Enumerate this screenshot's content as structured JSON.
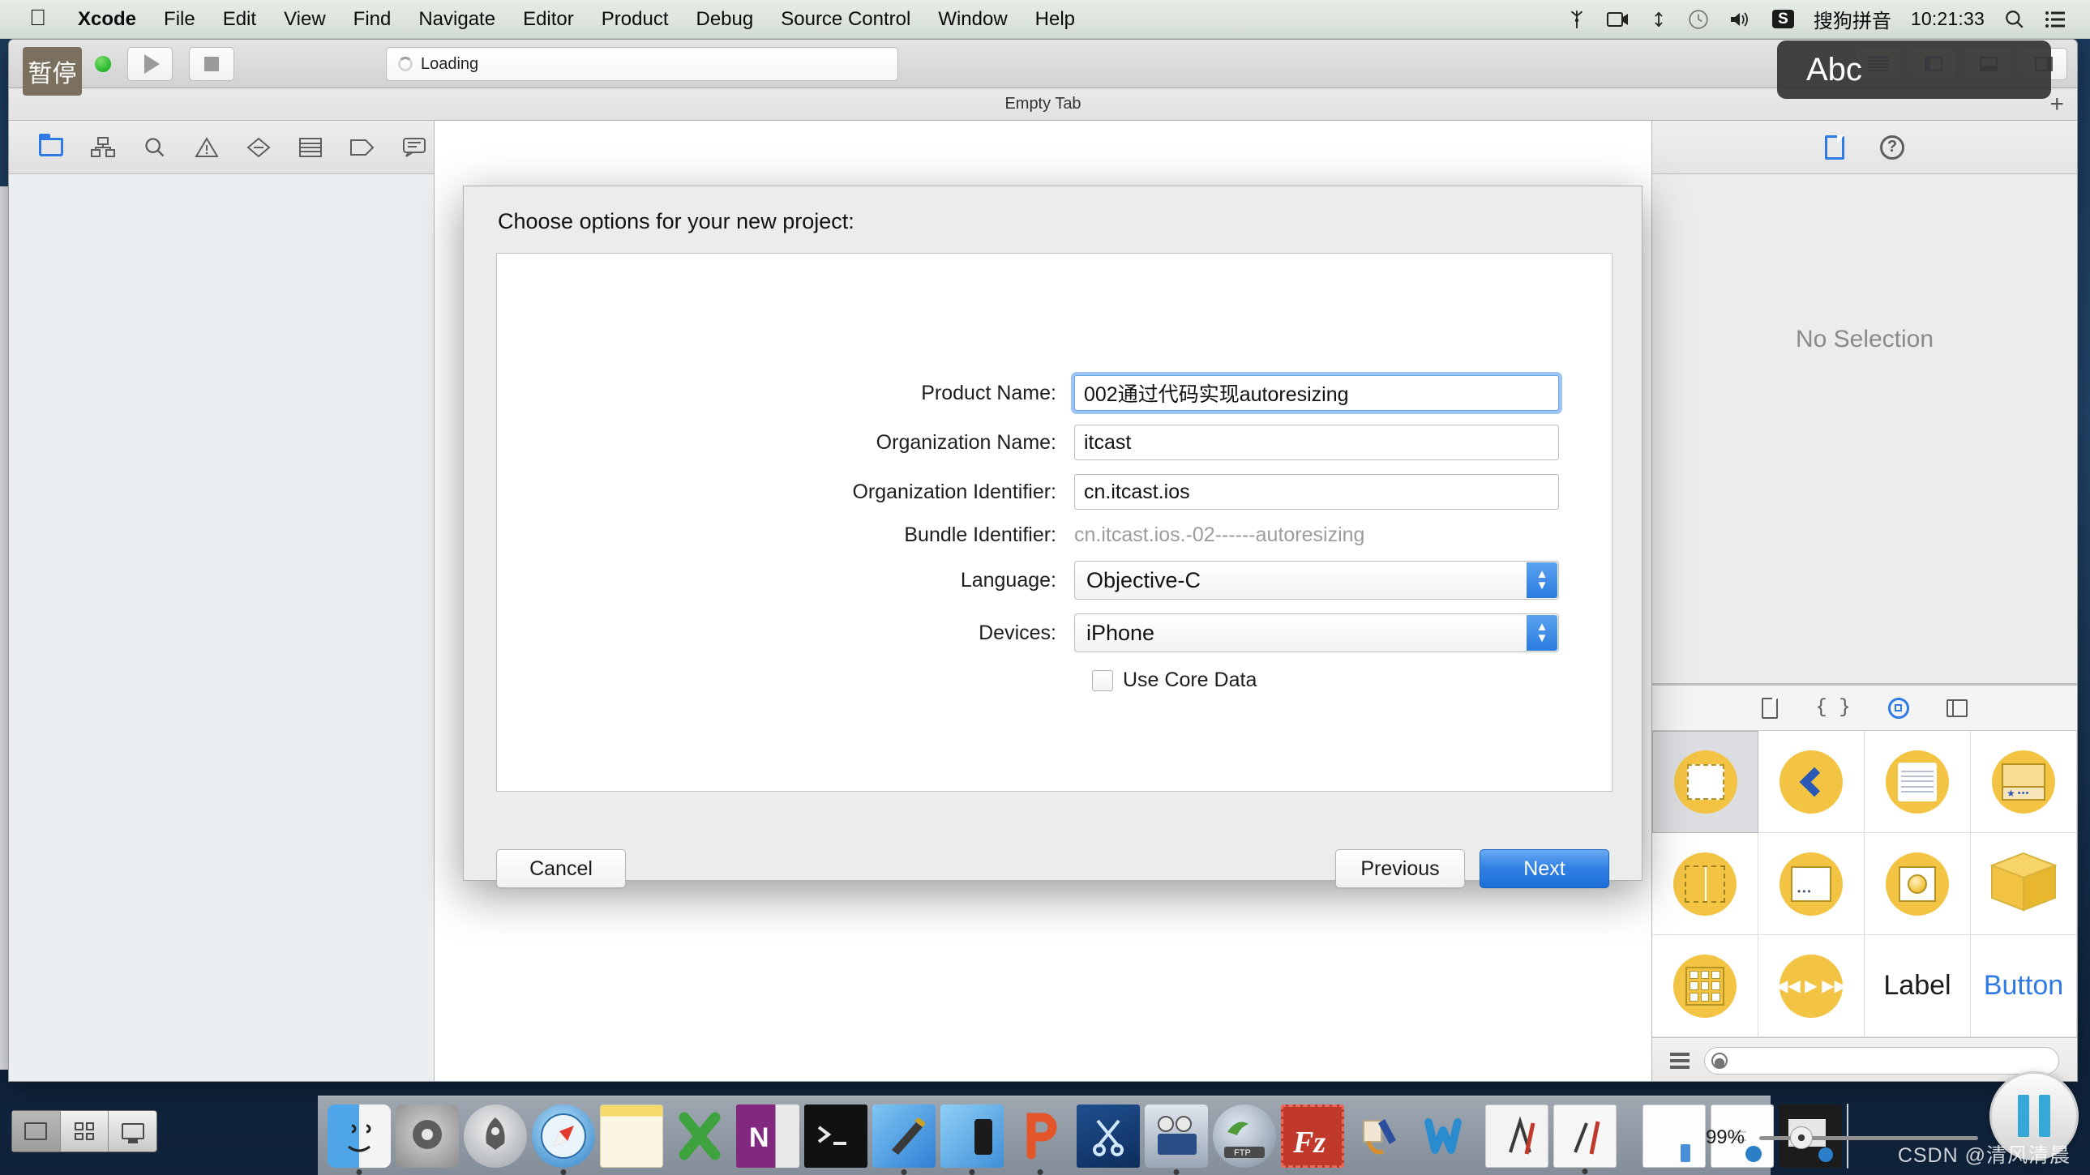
{
  "menubar": {
    "apple_icon": "apple-logo-icon",
    "items": [
      "Xcode",
      "File",
      "Edit",
      "View",
      "Find",
      "Navigate",
      "Editor",
      "Product",
      "Debug",
      "Source Control",
      "Window",
      "Help"
    ],
    "status_items": [
      {
        "name": "bluetooth-share-icon",
        "glyph": "✂"
      },
      {
        "name": "screen-record-icon",
        "glyph": "▣"
      },
      {
        "name": "airdrop-icon",
        "glyph": "⁂"
      },
      {
        "name": "time-machine-icon",
        "glyph": "⏱"
      },
      {
        "name": "volume-icon",
        "glyph": "ὐA"
      }
    ],
    "input_method_badge": "S",
    "input_method_label": "搜狗拼音",
    "clock": "10:21:33",
    "spotlight_icon": "search-icon",
    "notification_icon": "list-icon"
  },
  "overlay": {
    "pause_badge": "暂停",
    "abc_tooltip": "Abc"
  },
  "toolbar": {
    "run_icon": "play-icon",
    "stop_icon": "stop-icon",
    "status_text": "Loading",
    "status_spinner": "loading-spinner-icon"
  },
  "tabbar": {
    "tab_label": "Empty Tab",
    "add_tab": "+"
  },
  "navigator": {
    "icons": [
      "folder-icon",
      "hierarchy-icon",
      "search-icon",
      "warning-icon",
      "breakpoint-icon",
      "report-icon",
      "tag-icon",
      "comment-icon"
    ]
  },
  "inspector": {
    "tabs": [
      "file-inspector-icon",
      "quick-help-icon"
    ],
    "empty_text": "No Selection"
  },
  "library": {
    "tabs": [
      "file-template-icon",
      "code-snippet-icon",
      "object-library-icon",
      "media-library-icon"
    ],
    "items": [
      {
        "name": "view-controller",
        "label": ""
      },
      {
        "name": "navigation-controller",
        "label": ""
      },
      {
        "name": "table-view-controller",
        "label": ""
      },
      {
        "name": "tab-bar-controller",
        "label": ""
      },
      {
        "name": "split-view-controller",
        "label": ""
      },
      {
        "name": "page-view-controller",
        "label": ""
      },
      {
        "name": "glk-view-controller",
        "label": ""
      },
      {
        "name": "object-cube",
        "label": ""
      },
      {
        "name": "collection-view-controller",
        "label": ""
      },
      {
        "name": "av-player-controller",
        "label": ""
      },
      {
        "name": "label-object",
        "label": "Label"
      },
      {
        "name": "button-object",
        "label": "Button"
      }
    ],
    "filter_placeholder": ""
  },
  "dialog": {
    "title": "Choose options for your new project:",
    "fields": [
      {
        "label": "Product Name:",
        "value": "002通过代码实现autoresizing",
        "type": "text",
        "focused": true
      },
      {
        "label": "Organization Name:",
        "value": "itcast",
        "type": "text",
        "focused": false
      },
      {
        "label": "Organization Identifier:",
        "value": "cn.itcast.ios",
        "type": "text",
        "focused": false
      },
      {
        "label": "Bundle Identifier:",
        "value": "cn.itcast.ios.-02------autoresizing",
        "type": "static",
        "focused": false
      },
      {
        "label": "Language:",
        "value": "Objective-C",
        "type": "select",
        "focused": false
      },
      {
        "label": "Devices:",
        "value": "iPhone",
        "type": "select",
        "focused": false
      }
    ],
    "checkbox": {
      "label": "Use Core Data",
      "checked": false
    },
    "buttons": {
      "cancel": "Cancel",
      "previous": "Previous",
      "next": "Next"
    }
  },
  "dock": {
    "items": [
      {
        "name": "finder-icon",
        "running": true
      },
      {
        "name": "system-preferences-icon",
        "running": false
      },
      {
        "name": "launchpad-icon",
        "running": false
      },
      {
        "name": "safari-icon",
        "running": true
      },
      {
        "name": "notes-icon",
        "running": false
      },
      {
        "name": "excel-icon",
        "running": false
      },
      {
        "name": "onenote-icon",
        "running": false
      },
      {
        "name": "terminal-icon",
        "running": false
      },
      {
        "name": "xcode-icon",
        "running": true
      },
      {
        "name": "xcode-simulator-icon",
        "running": true
      },
      {
        "name": "powerpoint-icon",
        "running": true
      },
      {
        "name": "snip-tool-icon",
        "running": false
      },
      {
        "name": "imovie-icon",
        "running": true
      },
      {
        "name": "ftp-icon",
        "running": false
      },
      {
        "name": "filezilla-icon",
        "running": false
      },
      {
        "name": "paint-icon",
        "running": false
      },
      {
        "name": "word-icon",
        "running": false
      },
      {
        "name": "appstore-icon",
        "running": false
      },
      {
        "name": "sketch-icon",
        "running": true
      }
    ],
    "minimized": [
      {
        "name": "minimized-window-1"
      },
      {
        "name": "minimized-window-2"
      },
      {
        "name": "minimized-window-3"
      }
    ],
    "trash": "trash-icon"
  },
  "bottom_controls": {
    "view_modes": [
      "window-mode-icon",
      "grid-mode-icon",
      "display-mode-icon"
    ],
    "zoom_level": "99%",
    "pause_control": "pause-icon"
  },
  "watermark": "CSDN @清风清晨",
  "colors": {
    "accent": "#2f7ae5",
    "object_yellow": "#f3c444",
    "menubar_bg": "#dde5dd",
    "window_bg": "#ececec"
  }
}
